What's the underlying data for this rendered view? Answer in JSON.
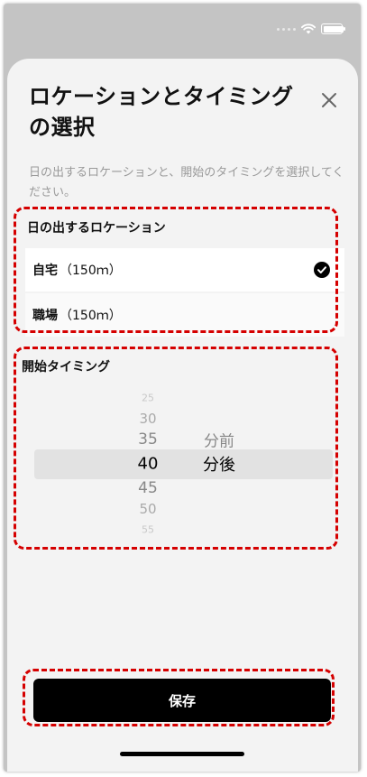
{
  "sheet": {
    "title": "ロケーションとタイミングの選択",
    "description": "日の出するロケーションと、開始のタイミングを選択してください。"
  },
  "location": {
    "label": "日の出するロケーション",
    "items": [
      {
        "name": "自宅",
        "distance": "（150ｍ）",
        "selected": true
      },
      {
        "name": "職場",
        "distance": "（150ｍ）",
        "selected": false
      }
    ]
  },
  "timing": {
    "label": "開始タイミング",
    "minutes": [
      "25",
      "30",
      "35",
      "40",
      "45",
      "50",
      "55"
    ],
    "selected_minute": "40",
    "relations": [
      "分前",
      "分後"
    ],
    "selected_relation": "分後"
  },
  "save_label": "保存",
  "colors": {
    "accent": "#000000",
    "highlight": "#d50000"
  }
}
